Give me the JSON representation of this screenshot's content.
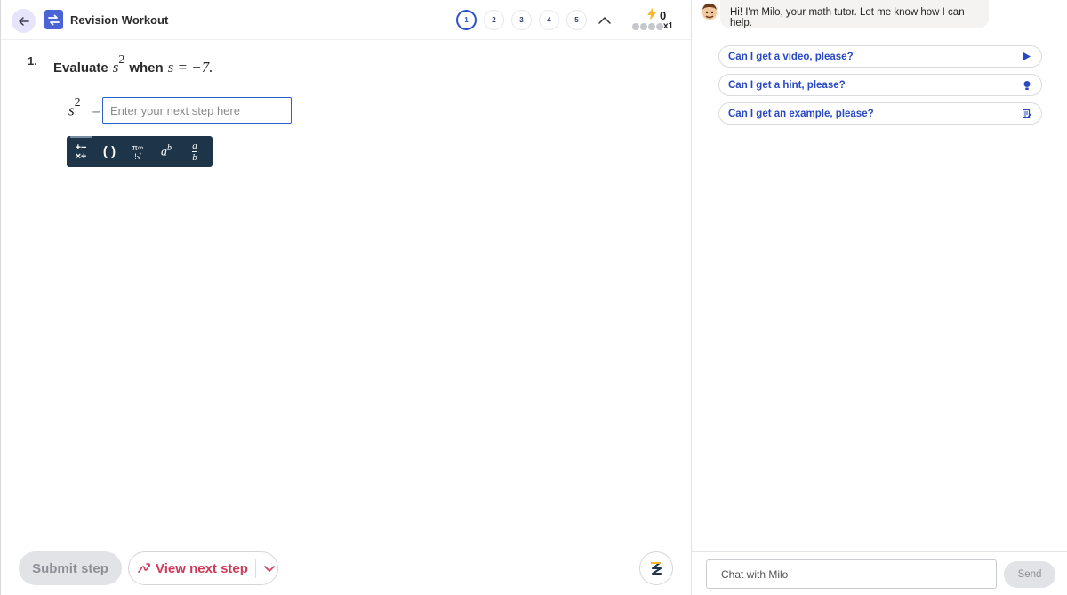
{
  "header": {
    "back_icon": "arrow-left-icon",
    "logo_icon": "revision-workout-logo-icon",
    "title": "Revision Workout",
    "steps": [
      "1",
      "2",
      "3",
      "4",
      "5"
    ],
    "active_step": "1",
    "collapse_icon": "chevron-up-icon",
    "streak": {
      "icon": "lightning-bolt-icon",
      "count": "0",
      "progress_dots_total": 4,
      "progress_dots_filled": 0,
      "multiplier": "x1"
    }
  },
  "problem": {
    "number": "1.",
    "prompt_word": "Evaluate",
    "variable": "s",
    "exponent": "2",
    "condition_word": "when",
    "condition_expr": "s = −7.",
    "lhs_variable": "s",
    "lhs_exponent": "2",
    "equals": "=",
    "input_value": "",
    "input_placeholder": "Enter your next step here"
  },
  "math_toolbar": {
    "ops_top": "+−",
    "ops_bottom": "×÷",
    "parens": "( )",
    "const_top": "π∞",
    "const_bottom": "!√",
    "power_base": "a",
    "power_exp": "b",
    "frac_num": "a",
    "frac_den": "b"
  },
  "footer": {
    "submit_label": "Submit step",
    "next_step_label": "View next step",
    "next_step_icon": "steps-icon",
    "dropdown_icon": "chevron-down-icon",
    "fab_icon": "milo-logo-icon"
  },
  "chat": {
    "avatar": "milo-avatar",
    "greeting": "Hi! I'm Milo, your math tutor. Let me know how I can help.",
    "chips": [
      {
        "label": "Can I get a video, please?",
        "icon": "play-icon"
      },
      {
        "label": "Can I get a hint, please?",
        "icon": "lightbulb-icon"
      },
      {
        "label": "Can I get an example, please?",
        "icon": "worked-example-icon"
      }
    ],
    "input_placeholder": "Chat with Milo",
    "send_label": "Send"
  },
  "colors": {
    "accent_blue": "#2b52c9",
    "toolbar_bg": "#1e3448",
    "next_step_red": "#d03a5a",
    "chip_text": "#2849c2",
    "back_button_bg": "#e5e4fb",
    "bolt_yellow": "#f5b82e"
  }
}
